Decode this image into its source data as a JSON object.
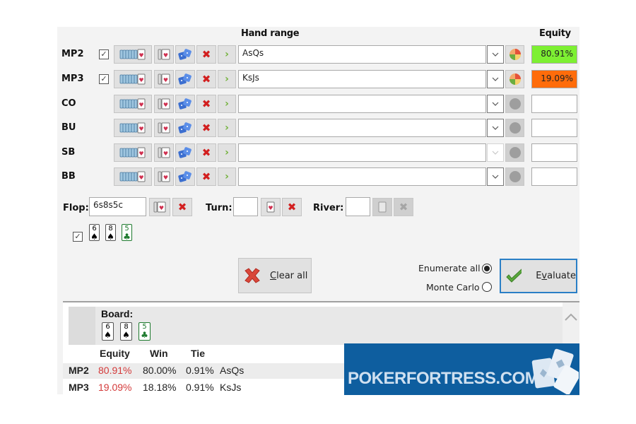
{
  "header": {
    "hand_range": "Hand range",
    "equity": "Equity"
  },
  "players": [
    {
      "position": "MP2",
      "checked": true,
      "range": "AsQs",
      "equity": "80.91%",
      "equity_color": "#7df032",
      "active": true
    },
    {
      "position": "MP3",
      "checked": true,
      "range": "KsJs",
      "equity": "19.09%",
      "equity_color": "#ff6c0a",
      "active": true
    },
    {
      "position": "CO",
      "checked": false,
      "range": "",
      "equity": "",
      "equity_color": "#ffffff",
      "active": false
    },
    {
      "position": "BU",
      "checked": false,
      "range": "",
      "equity": "",
      "equity_color": "#ffffff",
      "active": false
    },
    {
      "position": "SB",
      "checked": false,
      "range": "",
      "equity": "",
      "equity_color": "#ffffff",
      "active": false
    },
    {
      "position": "BB",
      "checked": false,
      "range": "",
      "equity": "",
      "equity_color": "#ffffff",
      "active": false
    }
  ],
  "board": {
    "flop_label": "Flop:",
    "flop_value": "6s8s5c",
    "turn_label": "Turn:",
    "turn_value": "",
    "river_label": "River:",
    "river_value": "",
    "cards": [
      {
        "rank": "6",
        "suit": "♠",
        "color": "#000000"
      },
      {
        "rank": "8",
        "suit": "♠",
        "color": "#000000"
      },
      {
        "rank": "5",
        "suit": "♣",
        "color": "#1e7a2e"
      }
    ]
  },
  "actions": {
    "clear_all": "Clear all",
    "evaluate": "Evaluate",
    "enumerate_all": "Enumerate all",
    "monte_carlo": "Monte Carlo",
    "mode_selected": "Enumerate all"
  },
  "results": {
    "board_label": "Board:",
    "columns": [
      "Equity",
      "Win",
      "Tie"
    ],
    "rows": [
      {
        "position": "MP2",
        "equity": "80.91%",
        "win": "80.00%",
        "tie": "0.91%",
        "hand": "AsQs"
      },
      {
        "position": "MP3",
        "equity": "19.09%",
        "win": "18.18%",
        "tie": "0.91%",
        "hand": "KsJs"
      }
    ]
  },
  "watermark": {
    "text": "POKERFORTRESS.COM"
  }
}
